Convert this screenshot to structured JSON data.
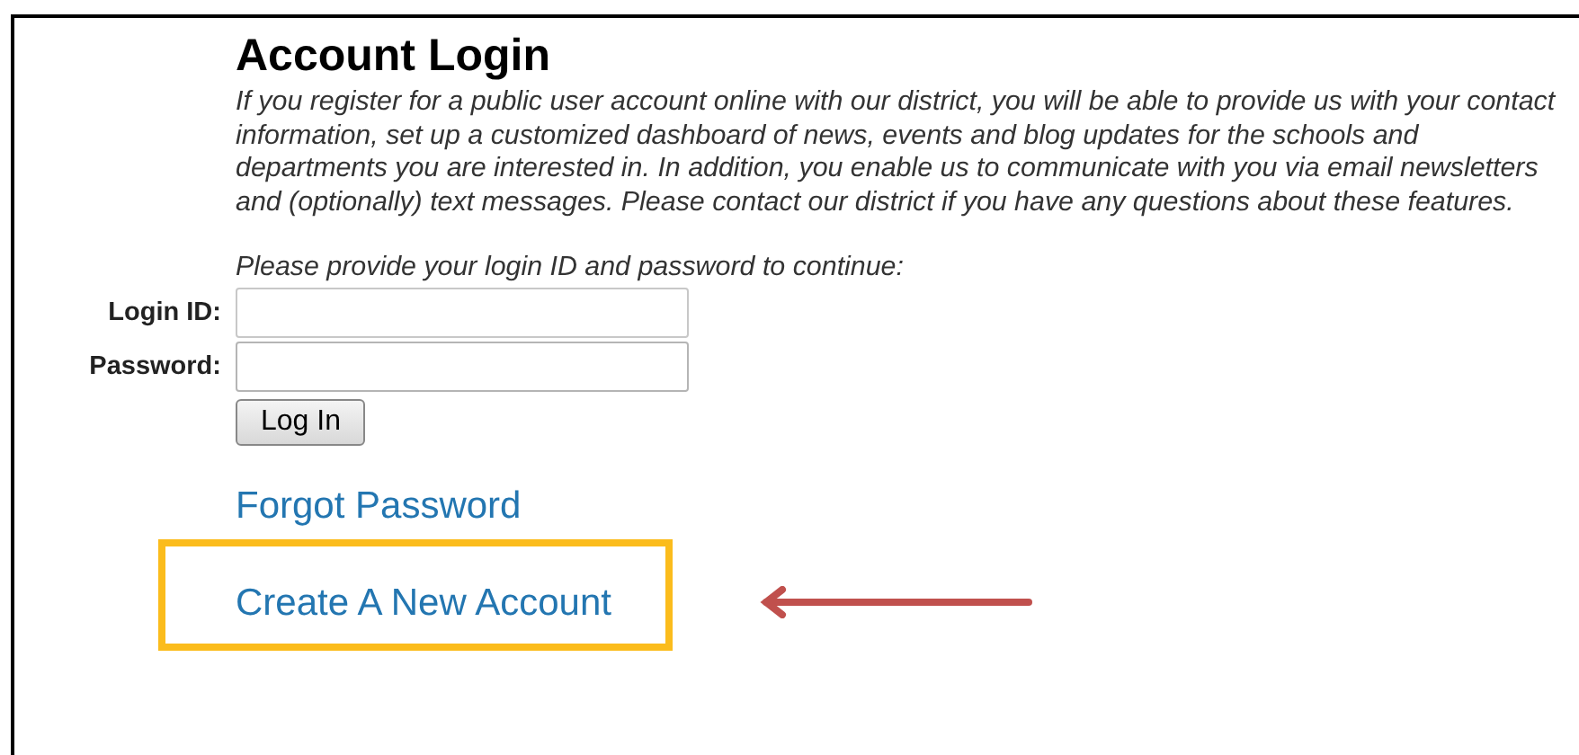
{
  "title": "Account Login",
  "intro": "If you register for a public user account online with our district, you will be able to provide us with your contact information, set up a customized dashboard of news, events and blog updates for the schools and departments you are interested in. In addition, you enable us to communicate with you via email newsletters and (optionally) text messages. Please contact our district if you have any questions about these features.",
  "prompt": "Please provide your login ID and password to continue:",
  "fields": [
    {
      "label": "Login ID:",
      "kind": "text"
    },
    {
      "label": "Password:",
      "kind": "password"
    }
  ],
  "login_button": "Log In",
  "links": [
    {
      "label": "Forgot Password",
      "highlighted": false
    },
    {
      "label": "Create A New Account",
      "highlighted": true
    }
  ]
}
